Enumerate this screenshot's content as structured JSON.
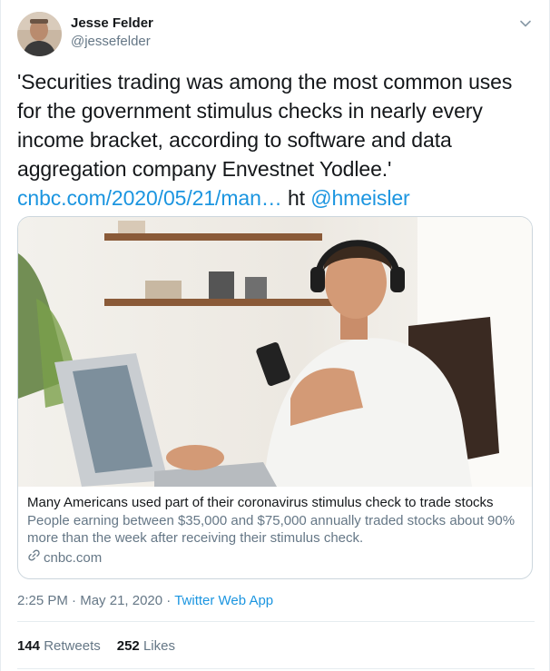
{
  "author": {
    "display_name": "Jesse Felder",
    "handle": "@jessefelder"
  },
  "tweet": {
    "text": "'Securities trading was among the most common uses for the government stimulus checks in nearly every income bracket, according to software and data aggregation company Envestnet Yodlee.' ",
    "link_text": "cnbc.com/2020/05/21/man…",
    "ht_text": " ht ",
    "mention": "@hmeisler"
  },
  "card": {
    "title": "Many Americans used part of their coronavirus stimulus check to trade stocks",
    "description": "People earning between $35,000 and $75,000 annually traded stocks about 90% more than the week after receiving their stimulus check.",
    "domain": "cnbc.com",
    "image_icon": "man-with-headphones-phone-laptop-photo"
  },
  "meta": {
    "time": "2:25 PM",
    "separator": " · ",
    "date": "May 21, 2020",
    "separator2": " · ",
    "app": "Twitter Web App"
  },
  "stats": {
    "retweets_count": "144",
    "retweets_label": "Retweets",
    "likes_count": "252",
    "likes_label": "Likes"
  },
  "colors": {
    "link": "#1b95e0",
    "secondary_text": "#657786",
    "primary_text": "#14171a",
    "border": "#ccd6dd"
  }
}
